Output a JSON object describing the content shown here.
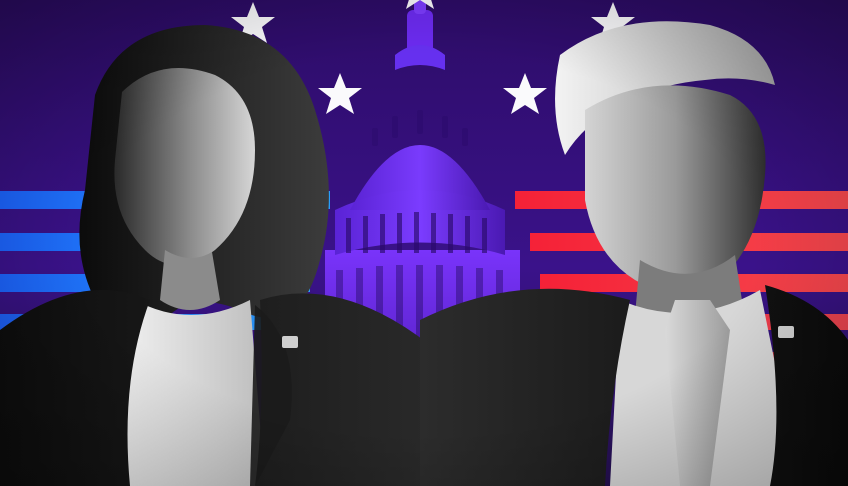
{
  "scene": {
    "background_color": "#2d0c67",
    "accent_colors": {
      "capitol_purple": "#6b2fe0",
      "left_stripes_blue": "#1f7bff",
      "right_stripes_red": "#ff2e3a",
      "stars_white": "#ffffff"
    },
    "elements": [
      {
        "name": "capitol-dome",
        "kind": "building"
      },
      {
        "name": "stars",
        "count": 6
      },
      {
        "name": "left-stripes",
        "count": 4
      },
      {
        "name": "right-stripes",
        "count": 5
      },
      {
        "name": "left-portrait",
        "tone": "black-and-white"
      },
      {
        "name": "right-portrait",
        "tone": "black-and-white"
      }
    ]
  }
}
